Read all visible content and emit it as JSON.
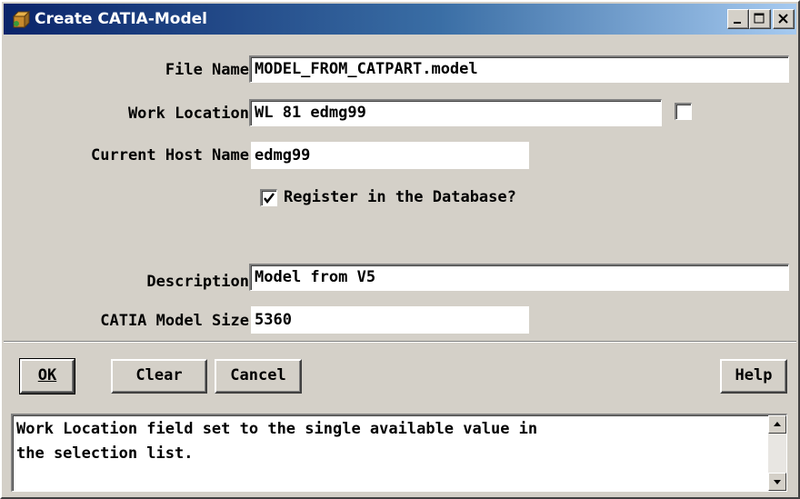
{
  "window": {
    "title": "Create CATIA-Model"
  },
  "titlebar": {
    "icon": "catia-app-icon",
    "buttons": [
      "minimize-icon",
      "maximize-icon",
      "close-icon"
    ]
  },
  "form": {
    "file_name": {
      "label": "File Name",
      "value": "MODEL_FROM_CATPART.model"
    },
    "work_location": {
      "label": "Work Location",
      "value": "WL  81 edmg99",
      "checked": false
    },
    "current_host": {
      "label": "Current Host Name",
      "value": "edmg99"
    },
    "register": {
      "label": "Register in the Database?",
      "checked": true
    },
    "description": {
      "label": "Description",
      "value": "Model from V5"
    },
    "model_size": {
      "label": "CATIA Model Size",
      "value": "5360"
    }
  },
  "actions": {
    "ok": "OK",
    "clear": "Clear",
    "cancel": "Cancel",
    "help": "Help"
  },
  "message": {
    "text": "Work Location field set to the single available value in\nthe selection list."
  }
}
